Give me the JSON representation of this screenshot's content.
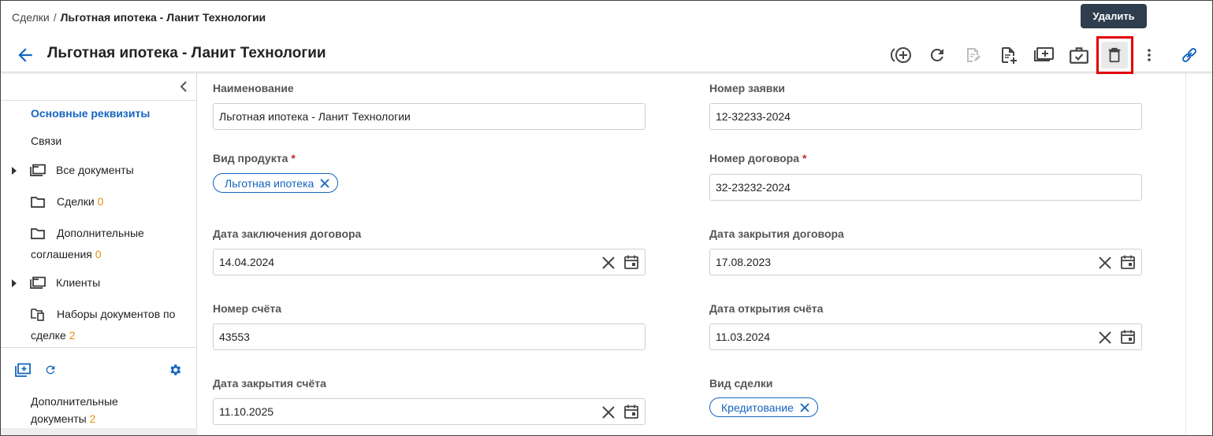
{
  "breadcrumb": {
    "parent": "Сделки",
    "separator": "/",
    "current": "Льготная ипотека - Ланит Технологии"
  },
  "title": "Льготная ипотека - Ланит Технологии",
  "tooltip": "Удалить",
  "toolbar": {
    "icons": [
      "add-circle-icon",
      "refresh-icon",
      "edit-document-icon",
      "add-document-icon",
      "add-folder-icon",
      "briefcase-check-icon",
      "trash-icon",
      "more-vert-icon",
      "link-icon"
    ],
    "highlighted": "trash-icon"
  },
  "sidebar": {
    "items": [
      {
        "label": "Основные реквизиты",
        "active": true
      },
      {
        "label": "Связи"
      },
      {
        "label": "Все документы",
        "expandable": true
      },
      {
        "label": "Сделки",
        "count": "0"
      },
      {
        "label_line1": "Дополнительные",
        "label_line2": "соглашения",
        "count": "0"
      },
      {
        "label": "Клиенты",
        "expandable": true
      },
      {
        "label_line1": "Наборы документов по",
        "label_line2": "сделке",
        "count": "2"
      }
    ],
    "extra_docs": {
      "line1": "Дополнительные",
      "line2": "документы",
      "count": "2"
    }
  },
  "form": {
    "name": {
      "label": "Наименование",
      "value": "Льготная ипотека - Ланит Технологии"
    },
    "application_number": {
      "label": "Номер заявки",
      "value": "12-32233-2024"
    },
    "product_type": {
      "label": "Вид продукта",
      "required_mark": "*",
      "chip": "Льготная ипотека"
    },
    "contract_number": {
      "label": "Номер договора",
      "required_mark": "*",
      "value": "32-23232-2024"
    },
    "contract_date": {
      "label": "Дата заключения договора",
      "value": "14.04.2024"
    },
    "contract_close_date": {
      "label": "Дата закрытия договора",
      "value": "17.08.2023"
    },
    "account_number": {
      "label": "Номер счёта",
      "value": "43553"
    },
    "account_open_date": {
      "label": "Дата открытия счёта",
      "value": "11.03.2024"
    },
    "account_close_date": {
      "label": "Дата закрытия счёта",
      "value": "11.10.2025"
    },
    "deal_type": {
      "label": "Вид сделки",
      "chip": "Кредитование"
    }
  },
  "colors": {
    "accent": "#1565c0",
    "count": "#e6900a",
    "required": "#c62828",
    "highlight_border": "#e00000",
    "tooltip_bg": "#2f3e4e"
  }
}
